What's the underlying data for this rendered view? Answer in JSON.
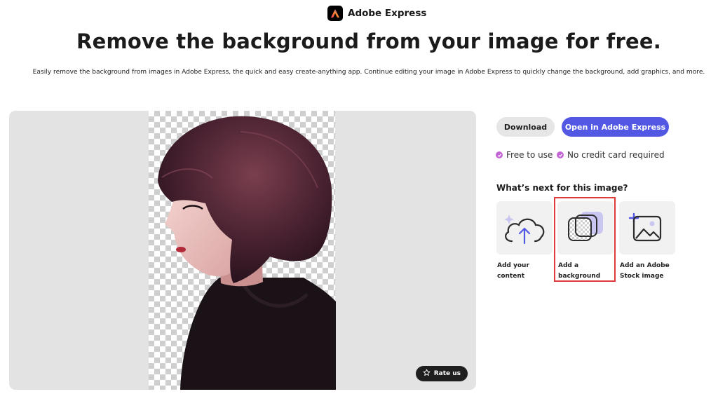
{
  "brand": {
    "name": "Adobe Express"
  },
  "hero": {
    "title": "Remove the background from your image for free.",
    "subtitle": "Easily remove the background from images in Adobe Express, the quick and easy create-anything app. Continue editing your image in Adobe Express to quickly change the background, add graphics, and more."
  },
  "preview": {
    "rate_label": "Rate us"
  },
  "actions": {
    "download_label": "Download",
    "open_label": "Open in Adobe Express"
  },
  "features": [
    {
      "label": "Free to use"
    },
    {
      "label": "No credit card required"
    }
  ],
  "next": {
    "heading": "What’s next for this image?",
    "cards": [
      {
        "label_line1": "Add your",
        "label_line2": "content",
        "icon": "cloud-upload-icon"
      },
      {
        "label_line1": "Add a",
        "label_line2": "background",
        "icon": "background-layers-icon",
        "selected": true
      },
      {
        "label_line1": "Add an Adobe",
        "label_line2": "Stock image",
        "icon": "add-image-icon"
      }
    ]
  },
  "colors": {
    "primary": "#5258e4",
    "secondary_button": "#e6e6e6",
    "bullet": "#c465d6",
    "highlight": "#e03a3a",
    "preview_bg": "#e3e3e3"
  }
}
